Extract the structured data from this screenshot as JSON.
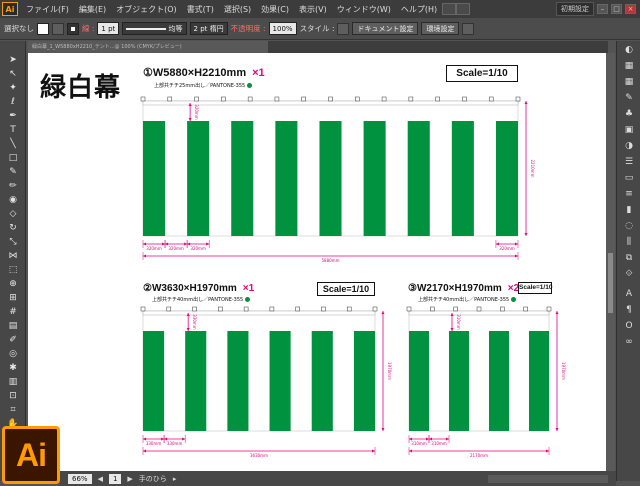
{
  "menu": {
    "logo": "Ai",
    "items": [
      "ファイル(F)",
      "編集(E)",
      "オブジェクト(O)",
      "書式(T)",
      "選択(S)",
      "効果(C)",
      "表示(V)",
      "ウィンドウ(W)",
      "ヘルプ(H)"
    ],
    "workspace": "初期設定"
  },
  "controlbar": {
    "selection": "選択なし",
    "stroke_label": "線 :",
    "stroke_weight": "1 pt",
    "profile": "均等",
    "brush": "2 pt 楕円",
    "opacity_label": "不透明度 :",
    "opacity": "100%",
    "style_label": "スタイル :",
    "doc_settings": "ドキュメント設定",
    "env_settings": "環境設定"
  },
  "doc_tab": "緑白幕_1_W5880xH2210_テント...@ 100% (CMYK/プレビュー)",
  "statusbar": {
    "zoom": "66%",
    "page": "1",
    "tool": "手のひら"
  },
  "colors": {
    "green": "#00923f",
    "magenta": "#e4007f",
    "accent": "#ff9a00"
  },
  "artwork": {
    "title": "緑白幕",
    "banners": [
      {
        "spec": "①W5880×H2210mm",
        "qty": "×1",
        "sub": "上部共チチ25mm出し／PANTONE-355",
        "scale": "Scale=1/10",
        "stripes": 17,
        "dims": {
          "stripe1": "320mm",
          "stripe2": "320mm",
          "stripe3": "320mm",
          "tab": "320mm",
          "right": "320mm",
          "height": "2210mm",
          "width": "5880mm"
        }
      },
      {
        "spec": "②W3630×H1970mm",
        "qty": "×1",
        "sub": "上部共チチ40mm出し／PANTONE-355",
        "scale": "Scale=1/10",
        "stripes": 11,
        "dims": {
          "stripe1": "330mm",
          "stripe2": "330mm",
          "tab": "330mm",
          "height": "1970mm",
          "width": "3630mm"
        }
      },
      {
        "spec": "③W2170×H1970mm",
        "qty": "×2",
        "sub": "上部共チチ40mm出し／PANTONE-355",
        "scale": "Scale=1/10",
        "stripes": 7,
        "dims": {
          "stripe1": "310mm",
          "stripe2": "310mm",
          "tab": "310mm",
          "height": "1970mm",
          "width": "2170mm"
        }
      }
    ]
  }
}
